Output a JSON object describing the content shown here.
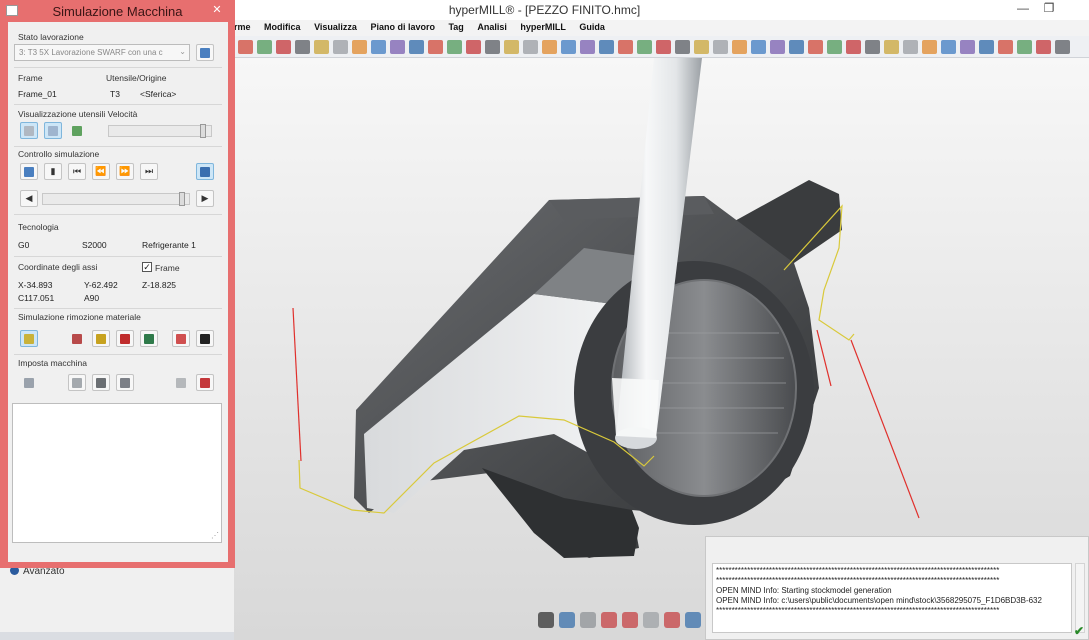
{
  "window": {
    "title": "hyperMILL® - [PEZZO FINITO.hmc]",
    "minimize": "—",
    "restore": "❐"
  },
  "menu": [
    "rme",
    "Modifica",
    "Visualizza",
    "Piano di lavoro",
    "Tag",
    "Analisi",
    "hyperMILL",
    "Guida"
  ],
  "dialog": {
    "title": "Simulazione Macchina",
    "close": "✕",
    "stato_lavorazione": {
      "label": "Stato lavorazione",
      "value": "3: T3 5X Lavorazione SWARF con una c"
    },
    "frame": {
      "label": "Frame",
      "value": "Frame_01"
    },
    "utensile": {
      "label": "Utensile/Origine",
      "tool": "T3",
      "origin": "<Sferica>"
    },
    "visualizzazione": {
      "label": "Visualizzazione utensili Velocità",
      "speed": 0.95
    },
    "controllo": {
      "label": "Controllo simulazione",
      "progress": 0.97
    },
    "tecnologia": {
      "label": "Tecnologia",
      "mode": "G0",
      "speed": "S2000",
      "coolant": "Refrigerante 1"
    },
    "coordinate": {
      "label": "Coordinate degli assi",
      "frame_label": "Frame",
      "frame_checked": "✓",
      "x": "X-34.893",
      "y": "Y-62.492",
      "z": "Z-18.825",
      "c": "C117.051",
      "a": "A90"
    },
    "rimozione": {
      "label": "Simulazione rimozione materiale"
    },
    "imposta": {
      "label": "Imposta macchina"
    }
  },
  "sidebar": {
    "avanzato": "Avanzato"
  },
  "console": {
    "lines": [
      "*******************************************************************************************",
      "*******************************************************************************************",
      "OPEN MIND Info:    Starting stockmodel generation",
      "OPEN MIND Info:    c:\\users\\public\\documents\\open mind\\stock\\3568295075_F1D6BD3B-632",
      "*******************************************************************************************"
    ],
    "ok": "✔"
  },
  "colors": {
    "dialog_frame": "#e76f6f",
    "toolpath": "#d9c93a",
    "vectors": "#e0302c"
  }
}
